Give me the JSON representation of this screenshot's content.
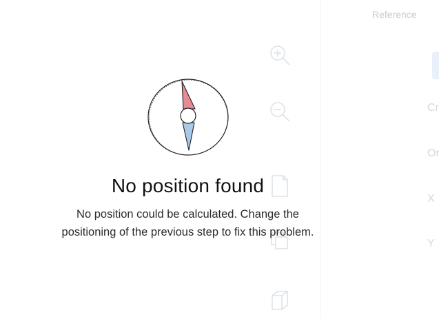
{
  "empty_state": {
    "title": "No position found",
    "description_line1": "No position could be calculated. Change the",
    "description_line2": "positioning of the previous step to fix this problem.",
    "icon": "compass-icon"
  },
  "toolbar": {
    "zoom_in_icon": "zoom-in-icon",
    "zoom_out_icon": "zoom-out-icon",
    "page_icon": "document-icon",
    "copy_icon": "copy-icon",
    "cube_icon": "cube-icon"
  },
  "reference_panel": {
    "title": "Reference",
    "labels": [
      "Cr",
      "Or",
      "X",
      "Y"
    ]
  },
  "colors": {
    "needle_north": "#e68a93",
    "needle_south": "#a9c8ea",
    "faded_icon": "#dde2e7",
    "faded_text": "#c6ccd3"
  }
}
